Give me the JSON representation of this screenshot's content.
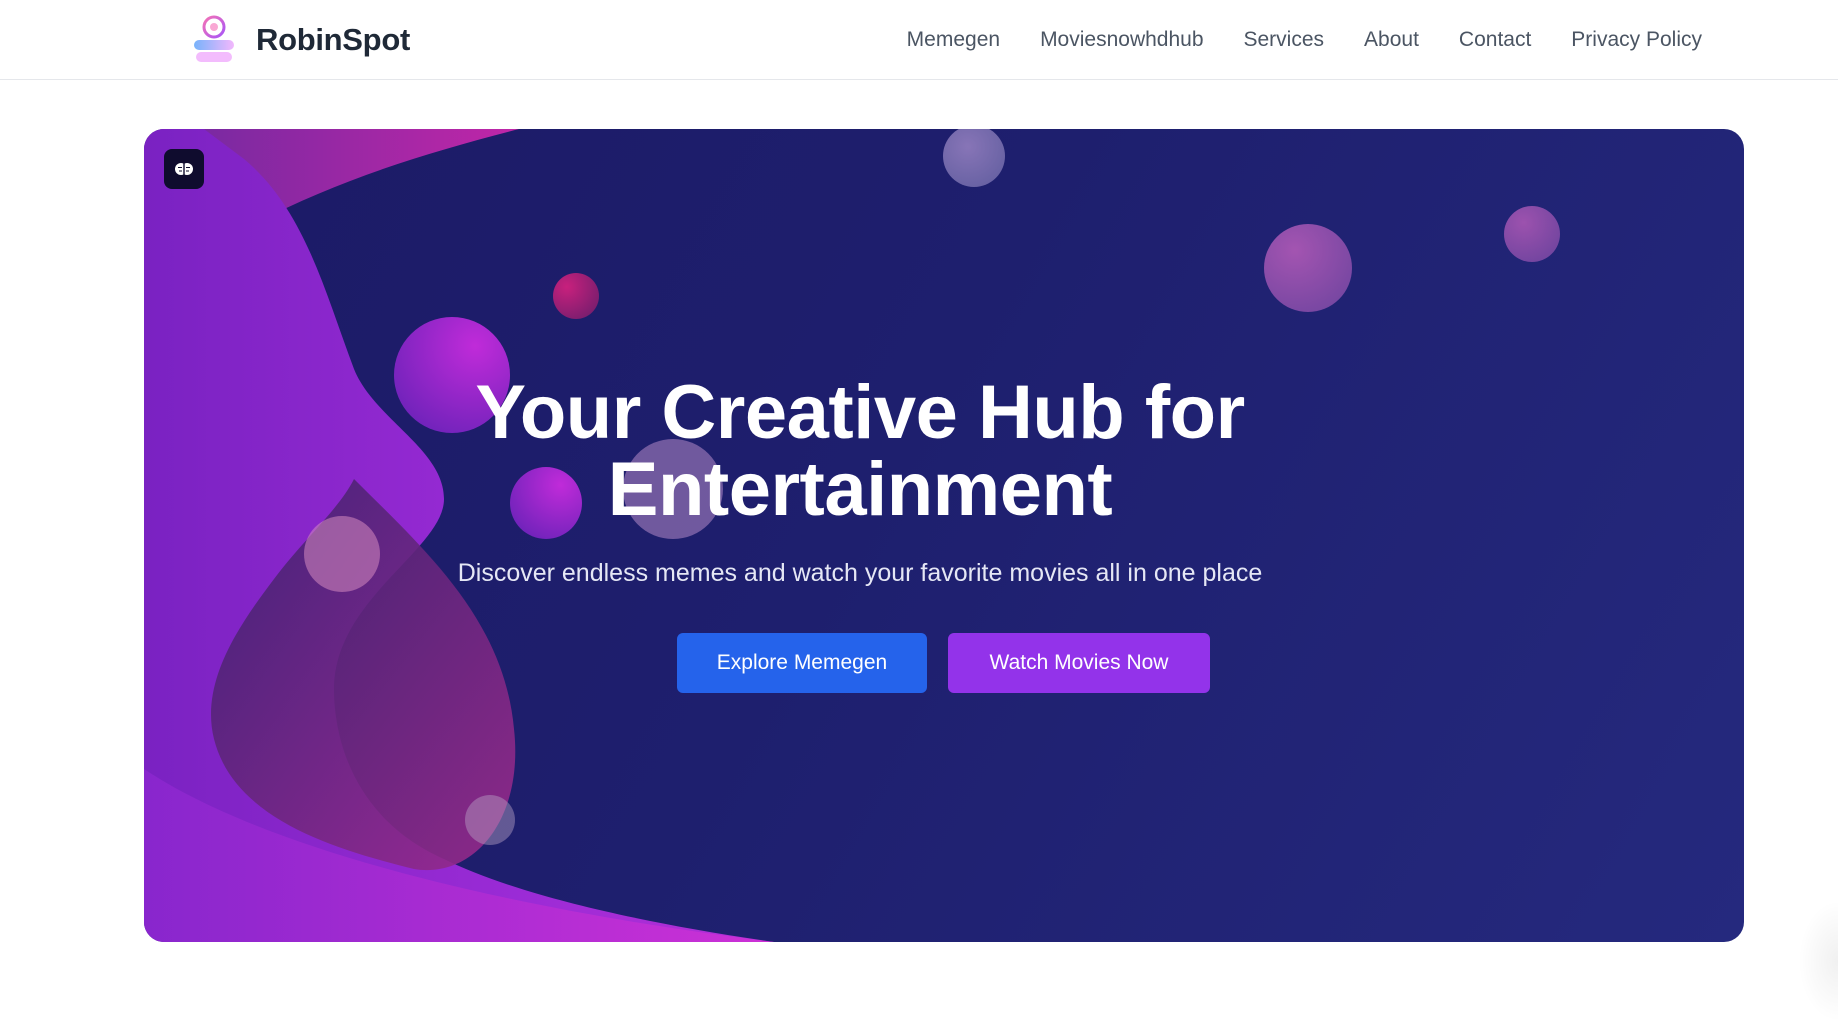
{
  "brand": {
    "name": "RobinSpot",
    "logo_icon": "robinspot-logo-icon"
  },
  "nav": {
    "items": [
      {
        "label": "Memegen"
      },
      {
        "label": "Moviesnowhdhub"
      },
      {
        "label": "Services"
      },
      {
        "label": "About"
      },
      {
        "label": "Contact"
      },
      {
        "label": "Privacy Policy"
      }
    ]
  },
  "hero": {
    "badge_icon": "brain-icon",
    "title_line1": "Your Creative Hub for",
    "title_line2": "Entertainment",
    "subtitle": "Discover endless memes and watch your favorite movies all in one place",
    "primary_button": "Explore Memegen",
    "secondary_button": "Watch Movies Now"
  },
  "colors": {
    "hero_background": "#1e1f6e",
    "wave_purple": "#a82ed8",
    "button_blue": "#2563eb",
    "button_purple": "#9333ea",
    "brand_text": "#1f2937",
    "nav_text": "#4b5563"
  }
}
